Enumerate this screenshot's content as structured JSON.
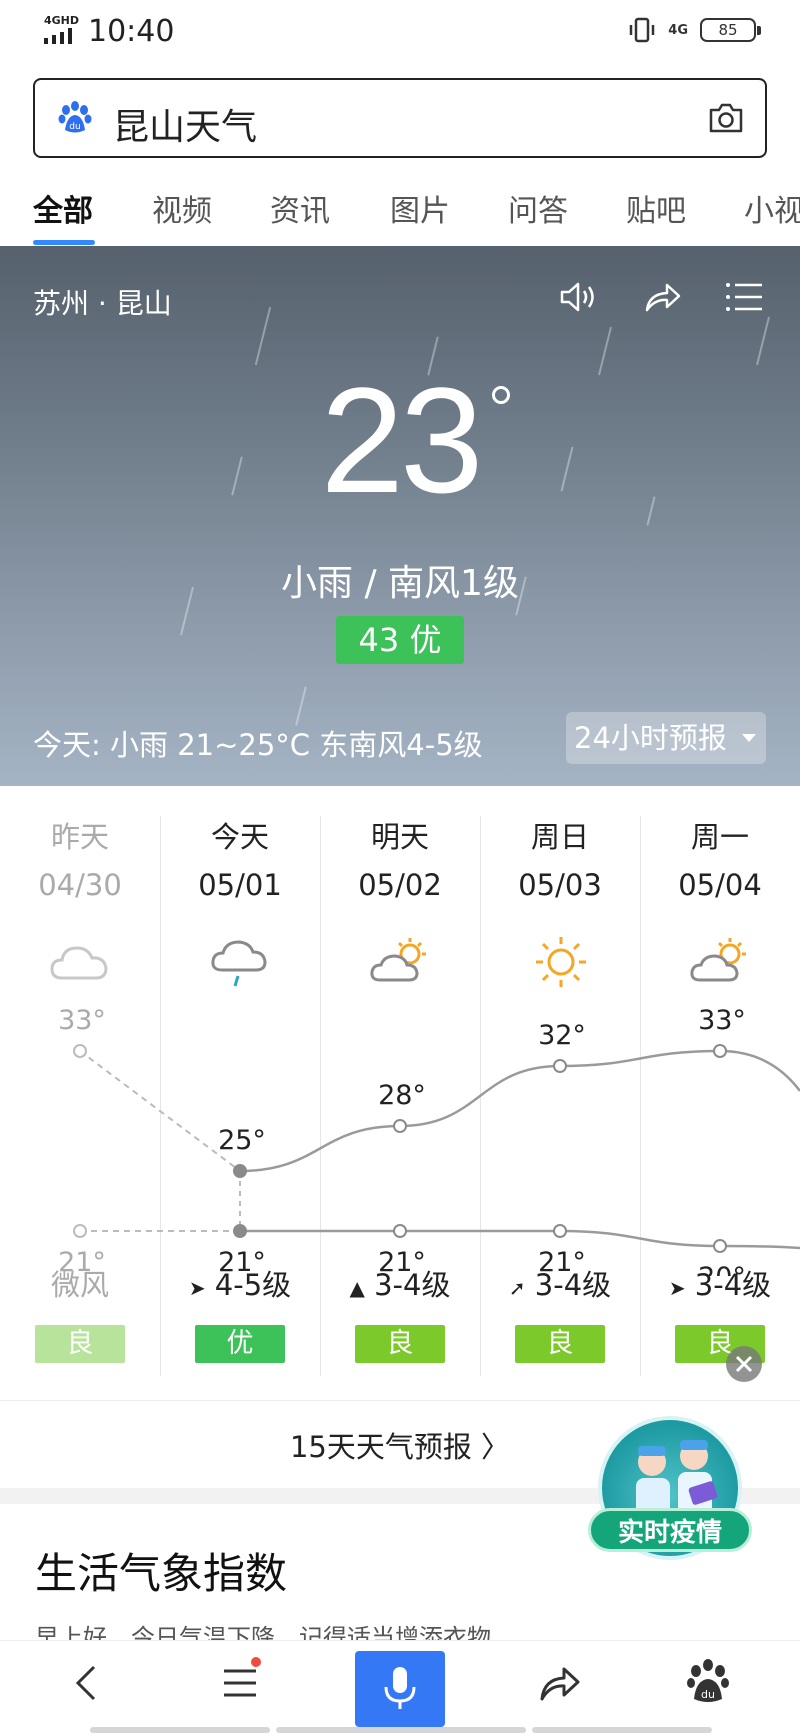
{
  "status_bar": {
    "network": "4GHD",
    "time": "10:40",
    "network_right": "4G",
    "battery": "85"
  },
  "search": {
    "query": "昆山天气"
  },
  "tabs": [
    "全部",
    "视频",
    "资讯",
    "图片",
    "问答",
    "贴吧",
    "小视"
  ],
  "weather": {
    "location": "苏州 · 昆山",
    "temperature": "23",
    "condition": "小雨  /  南风1级",
    "aqi": "43 优",
    "today_summary": "今天:  小雨   21~25°C   东南风4-5级",
    "hourly_button": "24小时预报"
  },
  "forecast": [
    {
      "day": "昨天",
      "date": "04/30",
      "icon": "cloudy-icon",
      "high": "33°",
      "low": "21°",
      "wind": "微风",
      "quality": "良",
      "quality_color": "#b8e39a",
      "past": true
    },
    {
      "day": "今天",
      "date": "05/01",
      "icon": "light-rain-icon",
      "high": "25°",
      "low": "21°",
      "wind": "4-5级",
      "quality": "优",
      "quality_color": "#3dc25a",
      "past": false
    },
    {
      "day": "明天",
      "date": "05/02",
      "icon": "partly-sunny-icon",
      "high": "28°",
      "low": "21°",
      "wind": "3-4级",
      "quality": "良",
      "quality_color": "#7cc92c",
      "past": false
    },
    {
      "day": "周日",
      "date": "05/03",
      "icon": "sunny-icon",
      "high": "32°",
      "low": "21°",
      "wind": "3-4级",
      "quality": "良",
      "quality_color": "#7cc92c",
      "past": false
    },
    {
      "day": "周一",
      "date": "05/04",
      "icon": "partly-sunny-icon",
      "high": "33°",
      "low": "20°",
      "wind": "3-4级",
      "quality": "良",
      "quality_color": "#7cc92c",
      "past": false
    }
  ],
  "fifteen_day_link": "15天天气预报  〉",
  "epidemic_badge": "实时疫情",
  "life_index": {
    "title": "生活气象指数",
    "subtitle": "早上好，今日气温下降，记得适当增添衣物"
  },
  "colors": {
    "accent": "#3388ff",
    "aqi_good": "#3dc25a",
    "aqi_moderate": "#7cc92c"
  }
}
